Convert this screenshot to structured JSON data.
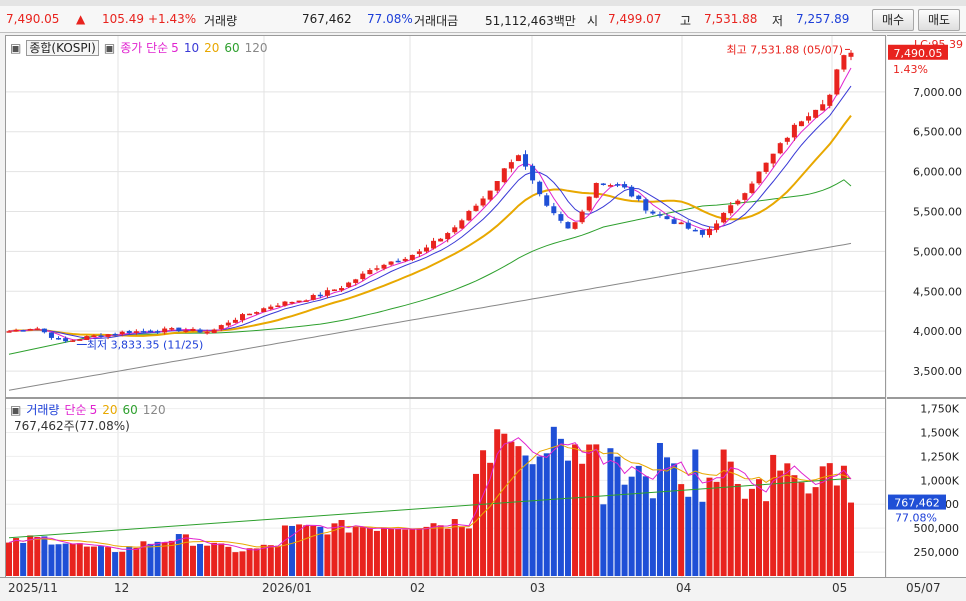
{
  "quote": {
    "price": "7,490.05",
    "arrow": "▲",
    "change": "105.49",
    "pct": "+1.43%",
    "vol_label": "거래량",
    "volume": "767,462",
    "vol_ratio": "77.08%",
    "amt_label": "거래대금",
    "amount": "51,112,463백만",
    "open_label": "시",
    "open": "7,499.07",
    "high_label": "고",
    "high": "7,531.88",
    "low_label": "저",
    "low": "7,257.89",
    "buy_label": "매수",
    "sell_label": "매도"
  },
  "price_panel": {
    "legend": {
      "name": "종합(KOSPI)",
      "close_label": "종가 단순",
      "ma5": "5",
      "ma10": "10",
      "ma20": "20",
      "ma60": "60",
      "ma120": "120"
    },
    "max_annotation": "최고 7,531.88 (05/07)",
    "min_annotation": "최저 3,833.35 (11/25)",
    "price_tag": "7,490.05",
    "pct_tag": "1.43%",
    "lc_tag": "LC:95.39",
    "y_ticks": [
      "7,000.00",
      "6,500.00",
      "6,000.00",
      "5,500.00",
      "5,000.00",
      "4,500.00",
      "4,000.00",
      "3,500.00"
    ]
  },
  "volume_panel": {
    "legend": {
      "name": "거래량",
      "label": "단순",
      "ma5": "5",
      "ma20": "20",
      "ma60": "60",
      "ma120": "120"
    },
    "sub": "767,462주(77.08%)",
    "vol_tag": "767,462",
    "pct_tag": "77.08%",
    "y_ticks": [
      "1,750K",
      "1,500K",
      "1,250K",
      "1,000K",
      "750,000",
      "500,000",
      "250,000"
    ]
  },
  "x_axis": {
    "labels": [
      "2025/11",
      "12",
      "2026/01",
      "02",
      "03",
      "04",
      "05"
    ],
    "right_label": "05/07"
  },
  "colors": {
    "up": "#e8231e",
    "down": "#1f4fd6",
    "ma5": "#e024d0",
    "ma10": "#3a3ad6",
    "ma20": "#e8a800",
    "ma60": "#2ea02e",
    "ma120": "#888888"
  },
  "chart_data": {
    "type": "candlestick",
    "title": "종합(KOSPI)",
    "x_labels": [
      "2025/11",
      "12",
      "2026/01",
      "02",
      "03",
      "04",
      "05"
    ],
    "price_range": [
      3200,
      7650
    ],
    "volume_range": [
      0,
      1850000
    ],
    "grid": true,
    "price_series": {
      "first_close": 4010,
      "last_close": 7490.05,
      "high": 7531.88,
      "low": 3833.35,
      "ma5_last": 6980,
      "ma10_last": 6750,
      "ma20_last": 6400,
      "ma60_last": 5820,
      "ma120_last": 5100
    },
    "volume_series": {
      "last": 767462,
      "peak": 1750000,
      "ma5_last": 860000,
      "ma20_last": 1010000,
      "ma60_last": 1020000
    }
  }
}
